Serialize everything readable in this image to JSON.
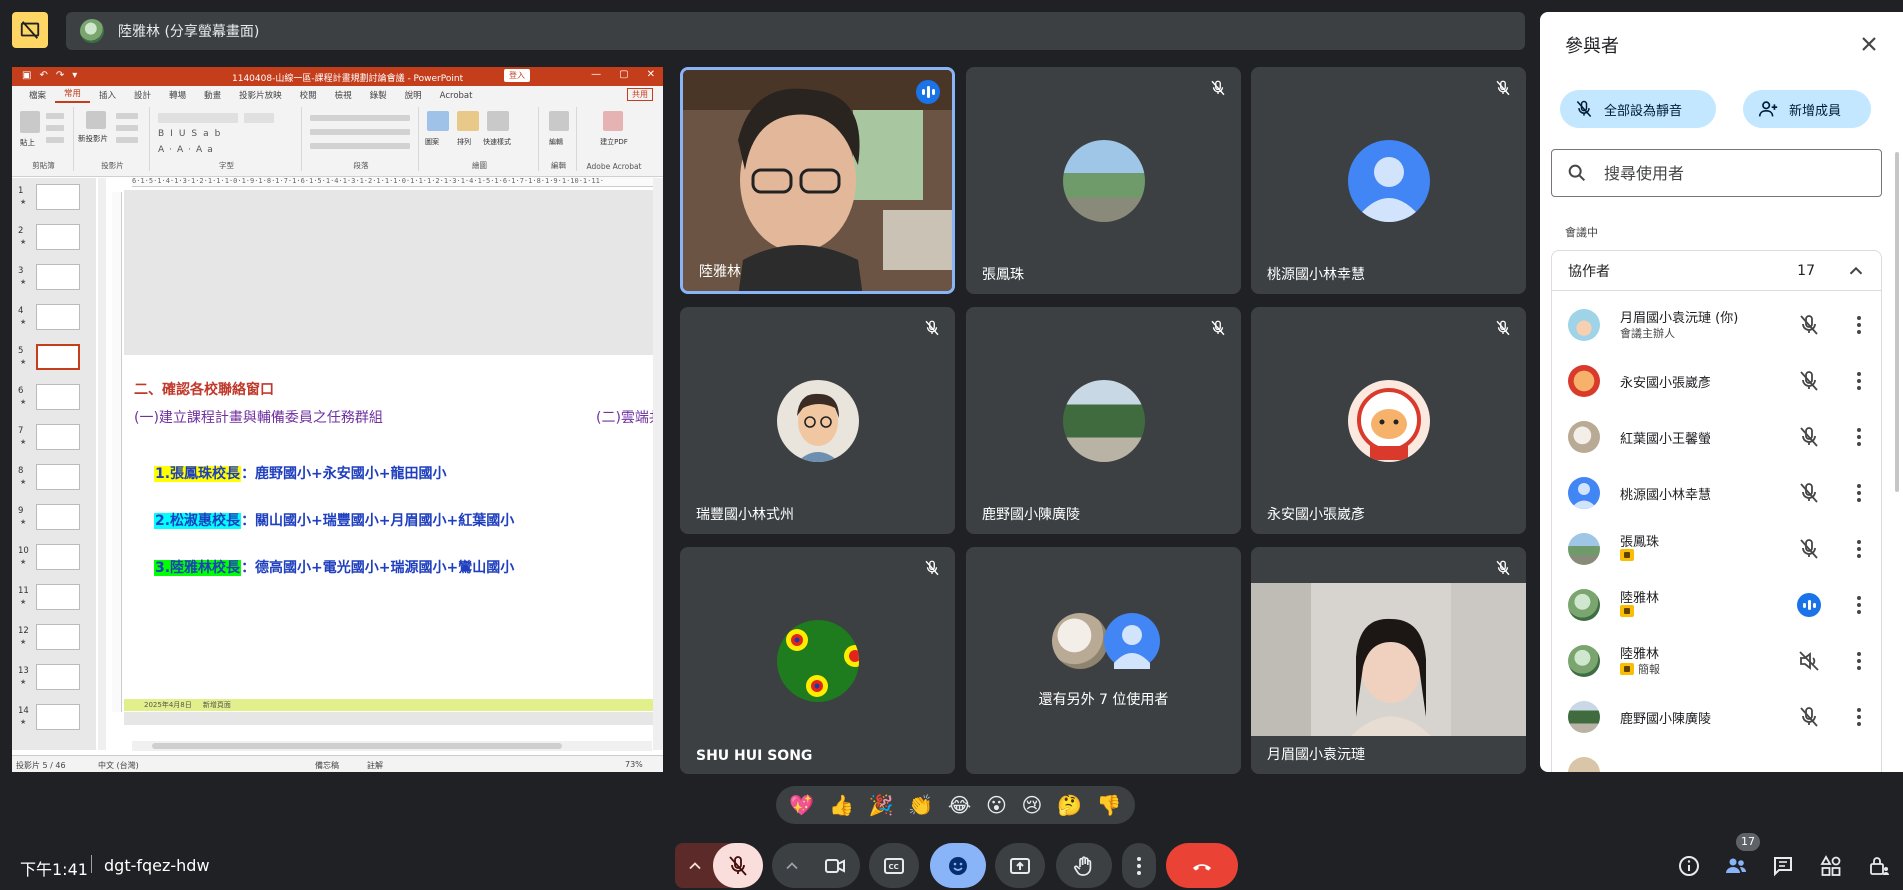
{
  "presenter_bar": {
    "text": "陸雅林 (分享螢幕畫面)"
  },
  "ppt": {
    "doc_title": "1140408-山線一區-課程計畫規劃討論會議 - PowerPoint",
    "sign_in": "登入",
    "tabs": [
      "檔案",
      "常用",
      "插入",
      "設計",
      "轉場",
      "動畫",
      "投影片放映",
      "校閱",
      "檢視",
      "錄製",
      "說明",
      "Acrobat"
    ],
    "share": "共用",
    "groups": [
      "剪貼簿",
      "投影片",
      "字型",
      "段落",
      "繪圖",
      "編輯",
      "Adobe Acrobat"
    ],
    "ribbon_labels": {
      "paste": "貼上",
      "new_slide": "新投影片",
      "shapes": "圖案",
      "arrange": "排列",
      "quick_styles": "快速樣式",
      "edit": "編輯",
      "create_pdf": "建立PDF"
    },
    "thumb_numbers": [
      "1",
      "2",
      "3",
      "4",
      "5",
      "6",
      "7",
      "8",
      "9",
      "10",
      "11",
      "12",
      "13",
      "14"
    ],
    "ruler": "6·1·5·1·4·1·3·1·2·1·1·1·0·1·9·1·8·1·7·1·6·1·5·1·4·1·3·1·2·1·1·1·0·1·1·1·2·1·3·1·4·1·5·1·6·1·7·1·8·1·9·1·10·1·11·",
    "slide": {
      "heading": "二、確認各校聯絡窗口",
      "sub1": "(一)建立課程計畫與輔備委員之任務群組",
      "sub2": "(二)雲端共",
      "lines": [
        {
          "leader": "1.張鳳珠校長",
          "rest": "：鹿野國小+永安國小+龍田國小",
          "color": "#ffff00"
        },
        {
          "leader": "2.松淑惠校長",
          "rest": "：關山國小+瑞豐國小+月眉國小+紅葉國小",
          "color": "#00ffff"
        },
        {
          "leader": "3.陸雅林校長",
          "rest": "：德高國小+電光國小+瑞源國小+鸞山國小",
          "color": "#00ff00"
        }
      ],
      "footer_date": "2025年4月8日",
      "footer_tag": "新增頁面"
    },
    "status": {
      "slide_pos": "投影片 5 / 46",
      "lang": "中文 (台灣)",
      "notes": "備忘稿",
      "comments": "註解",
      "zoom": "73%"
    }
  },
  "tiles": [
    {
      "name": "陸雅林"
    },
    {
      "name": "張鳳珠"
    },
    {
      "name": "桃源國小林幸慧"
    },
    {
      "name": "瑞豐國小林式州"
    },
    {
      "name": "鹿野國小陳廣陵"
    },
    {
      "name": "永安國小張崴彥"
    },
    {
      "name": "SHU HUI SONG"
    },
    {
      "name": "",
      "others": "還有另外 7 位使用者"
    },
    {
      "name": "月眉國小袁沅璉"
    }
  ],
  "reactions": [
    "💖",
    "👍",
    "🎉",
    "👏",
    "😂",
    "😮",
    "😢",
    "🤔",
    "👎"
  ],
  "bottom": {
    "time": "下午1:41",
    "code": "dgt-fqez-hdw",
    "people_count": "17"
  },
  "panel": {
    "title": "參與者",
    "mute_all": "全部設為靜音",
    "add_people": "新增成員",
    "search_placeholder": "搜尋使用者",
    "in_call": "會議中",
    "group_name": "協作者",
    "group_count": "17",
    "participants": [
      {
        "name": "月眉國小袁沅璉 (你)",
        "sub": "會議主辦人"
      },
      {
        "name": "永安國小張崴彥",
        "sub": ""
      },
      {
        "name": "紅葉國小王馨螢",
        "sub": ""
      },
      {
        "name": "桃源國小林幸慧",
        "sub": ""
      },
      {
        "name": "張鳳珠",
        "sub": ""
      },
      {
        "name": "陸雅林",
        "sub": ""
      },
      {
        "name": "陸雅林",
        "sub": "簡報"
      },
      {
        "name": "鹿野國小陳廣陵",
        "sub": ""
      }
    ]
  },
  "colors": {
    "accent": "#1a73e8",
    "end_call": "#ea4335",
    "mic_off": "#f9dedc",
    "ppt_brand": "#c43e1c",
    "stop_share": "#fdd663"
  }
}
